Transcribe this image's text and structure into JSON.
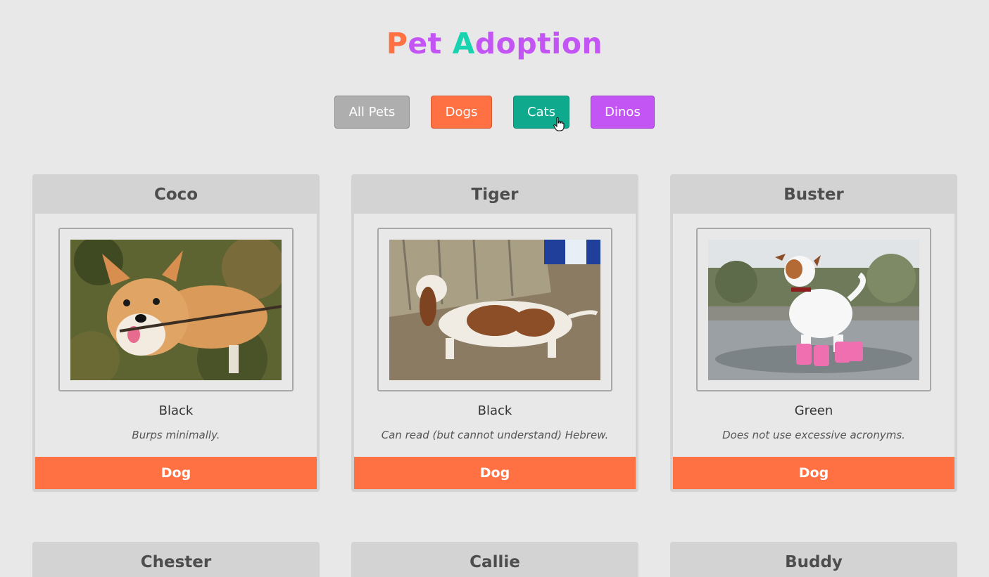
{
  "header": {
    "title_part1_initial": "P",
    "title_part1_rest": "et",
    "title_part2_initial": "A",
    "title_part2_rest": "doption"
  },
  "filters": [
    {
      "label": "All Pets",
      "color": "#aeaeae"
    },
    {
      "label": "Dogs",
      "color": "#ff7043"
    },
    {
      "label": "Cats",
      "color": "#0fa98d"
    },
    {
      "label": "Dinos",
      "color": "#c455f5"
    }
  ],
  "pets": [
    {
      "name": "Coco",
      "color": "Black",
      "description": "Burps minimally.",
      "type": "Dog",
      "photo": "corgi-with-stick"
    },
    {
      "name": "Tiger",
      "color": "Black",
      "description": "Can read (but cannot understand) Hebrew.",
      "type": "Dog",
      "photo": "basset-hound"
    },
    {
      "name": "Buster",
      "color": "Green",
      "description": "Does not use excessive acronyms.",
      "type": "Dog",
      "photo": "terrier-in-pink-boots"
    },
    {
      "name": "Chester"
    },
    {
      "name": "Callie"
    },
    {
      "name": "Buddy"
    }
  ],
  "theme": {
    "accent_dog": "#ff7043",
    "accent_cat": "#0fa98d",
    "accent_dino": "#c455f5"
  }
}
